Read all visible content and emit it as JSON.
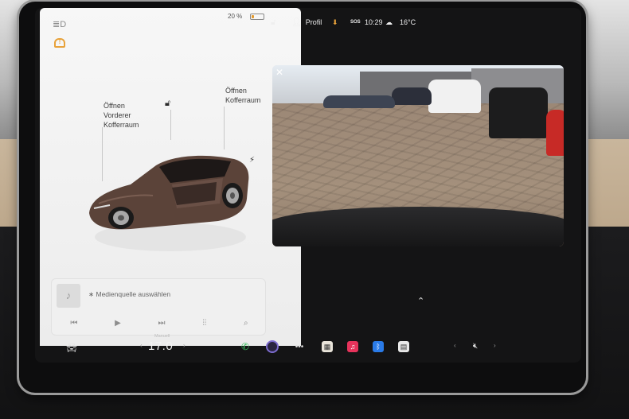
{
  "status_bar": {
    "profile_label": "Profil",
    "sos_label": "SOS",
    "time": "10:29",
    "temperature": "16°C",
    "battery_percent": "20 %",
    "battery_level": 0.2
  },
  "car_panel": {
    "frunk_label": "Öffnen\nVorderer\nKofferraum",
    "trunk_label": "Öffnen\nKofferraum",
    "media_source": "Medienquelle auswählen"
  },
  "climate": {
    "mode": "Manuell",
    "temperature": "17.0"
  },
  "colors": {
    "accent_orange": "#e8a23a",
    "panel_bg": "#f7f7f7",
    "screen_bg": "#141415",
    "car_paint": "#5b4339"
  },
  "icons": {
    "headlight": "headlight-icon",
    "tpms_warning": "tire-pressure-warning-icon",
    "lock": "lock-open-icon",
    "charge": "lightning-icon",
    "bluetooth": "bluetooth-icon",
    "close": "close-icon",
    "chevron_up": "chevron-up-icon"
  }
}
